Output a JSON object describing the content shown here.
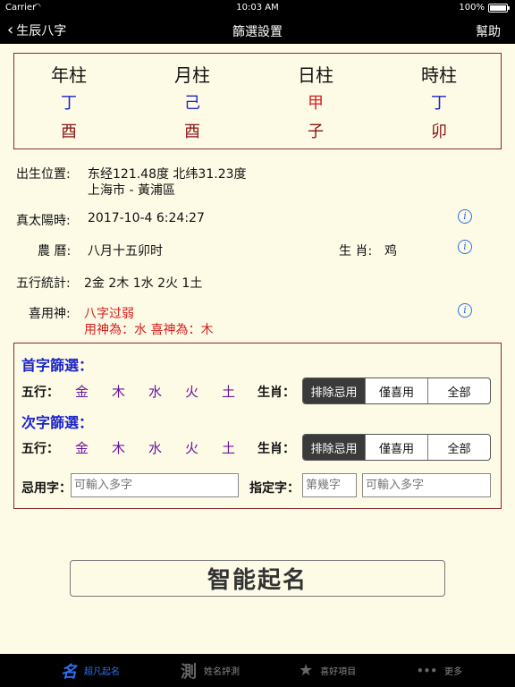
{
  "status_bar": {
    "carrier": "Carrier",
    "time": "10:03 AM",
    "battery": "100%"
  },
  "nav": {
    "back_label": "生辰八字",
    "title": "篩選設置",
    "help_label": "幫助"
  },
  "pillars": [
    {
      "head": "年柱",
      "stem": "丁",
      "branch": "酉"
    },
    {
      "head": "月柱",
      "stem": "己",
      "branch": "酉"
    },
    {
      "head": "日柱",
      "stem": "甲",
      "branch": "子"
    },
    {
      "head": "時柱",
      "stem": "丁",
      "branch": "卯"
    }
  ],
  "info": {
    "birthplace_label": "出生位置:",
    "birthplace_coords": "东经121.48度 北纬31.23度",
    "birthplace_city": "上海市 - 黃浦區",
    "solar_label": "真太陽時:",
    "solar_value": "2017-10-4 6:24:27",
    "lunar_label": "農 曆:",
    "lunar_value": "八月十五卯时",
    "zodiac_label": "生 肖:",
    "zodiac_value": "鸡",
    "wuxing_label": "五行統計:",
    "wuxing_value": "2金 2木 1水 2火 1土",
    "xiyong_label": "喜用神:",
    "xiyong_line1": "八字过弱",
    "xiyong_line2": "用神為：水  喜神為：木"
  },
  "filter": {
    "first_title": "首字篩選：",
    "second_title": "次字篩選：",
    "wuxing_label": "五行：",
    "elements": [
      "金",
      "木",
      "水",
      "火",
      "土"
    ],
    "zodiac_label": "生肖：",
    "segment_options": [
      "排除忌用",
      "僅喜用",
      "全部"
    ],
    "first_selected": "排除忌用",
    "second_selected": "排除忌用",
    "avoid_label": "忌用字：",
    "avoid_placeholder": "可輸入多字",
    "specify_label": "指定字：",
    "position_placeholder": "第幾字",
    "specify_placeholder": "可輸入多字"
  },
  "smart_button": "智能起名",
  "tabs": [
    {
      "icon": "名",
      "label": "超凡起名",
      "active": true
    },
    {
      "icon": "測",
      "label": "姓名評測",
      "active": false
    },
    {
      "icon": "★",
      "label": "喜好項目",
      "active": false
    },
    {
      "icon": "•••",
      "label": "更多",
      "active": false
    }
  ],
  "colors": {
    "accent": "#2b6ff0",
    "stem_blue": "#1b24c8",
    "red": "#d81b1b",
    "element_purple": "#6a14a0",
    "border": "#8b2a2a",
    "background": "#fdfbe6"
  }
}
